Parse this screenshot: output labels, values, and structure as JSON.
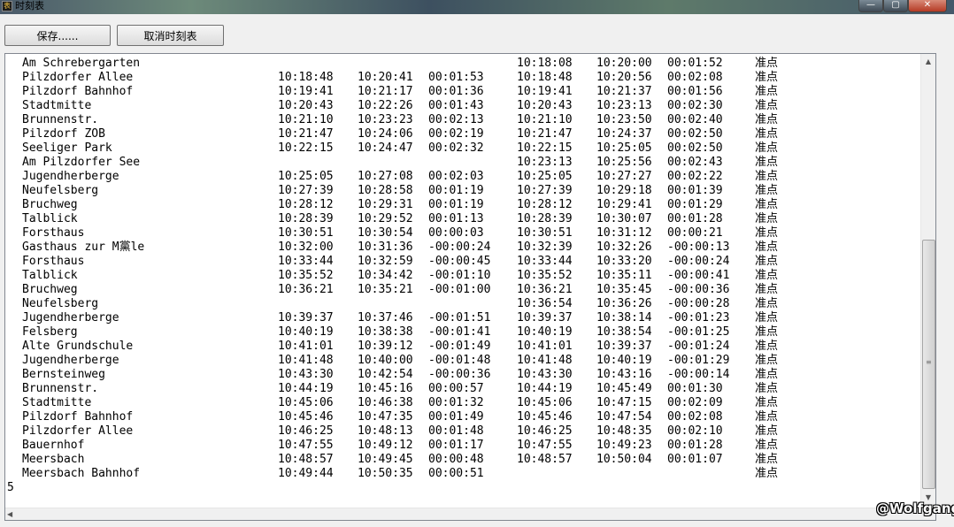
{
  "window": {
    "title": "时刻表",
    "app_icon": "timetable-app-icon",
    "controls": {
      "minimize": "—",
      "maximize": "▢",
      "close": "✕"
    }
  },
  "toolbar": {
    "save_label": "保存......",
    "cancel_label": "取消时刻表"
  },
  "timetable": {
    "rows": [
      [
        "Am Schrebergarten",
        "",
        "",
        "",
        "10:18:08",
        "10:20:00",
        "00:01:52",
        "准点"
      ],
      [
        "Pilzdorfer Allee",
        "10:18:48",
        "10:20:41",
        "00:01:53",
        "10:18:48",
        "10:20:56",
        "00:02:08",
        "准点"
      ],
      [
        "Pilzdorf Bahnhof",
        "10:19:41",
        "10:21:17",
        "00:01:36",
        "10:19:41",
        "10:21:37",
        "00:01:56",
        "准点"
      ],
      [
        "Stadtmitte",
        "10:20:43",
        "10:22:26",
        "00:01:43",
        "10:20:43",
        "10:23:13",
        "00:02:30",
        "准点"
      ],
      [
        "Brunnenstr.",
        "10:21:10",
        "10:23:23",
        "00:02:13",
        "10:21:10",
        "10:23:50",
        "00:02:40",
        "准点"
      ],
      [
        "Pilzdorf ZOB",
        "10:21:47",
        "10:24:06",
        "00:02:19",
        "10:21:47",
        "10:24:37",
        "00:02:50",
        "准点"
      ],
      [
        "Seeliger Park",
        "10:22:15",
        "10:24:47",
        "00:02:32",
        "10:22:15",
        "10:25:05",
        "00:02:50",
        "准点"
      ],
      [
        "Am Pilzdorfer See",
        "",
        "",
        "",
        "10:23:13",
        "10:25:56",
        "00:02:43",
        "准点"
      ],
      [
        "Jugendherberge",
        "10:25:05",
        "10:27:08",
        "00:02:03",
        "10:25:05",
        "10:27:27",
        "00:02:22",
        "准点"
      ],
      [
        "Neufelsberg",
        "10:27:39",
        "10:28:58",
        "00:01:19",
        "10:27:39",
        "10:29:18",
        "00:01:39",
        "准点"
      ],
      [
        "Bruchweg",
        "10:28:12",
        "10:29:31",
        "00:01:19",
        "10:28:12",
        "10:29:41",
        "00:01:29",
        "准点"
      ],
      [
        "Talblick",
        "10:28:39",
        "10:29:52",
        "00:01:13",
        "10:28:39",
        "10:30:07",
        "00:01:28",
        "准点"
      ],
      [
        "Forsthaus",
        "10:30:51",
        "10:30:54",
        "00:00:03",
        "10:30:51",
        "10:31:12",
        "00:00:21",
        "准点"
      ],
      [
        "Gasthaus zur M黨le",
        "10:32:00",
        "10:31:36",
        "-00:00:24",
        "10:32:39",
        "10:32:26",
        "-00:00:13",
        "准点"
      ],
      [
        "Forsthaus",
        "10:33:44",
        "10:32:59",
        "-00:00:45",
        "10:33:44",
        "10:33:20",
        "-00:00:24",
        "准点"
      ],
      [
        "Talblick",
        "10:35:52",
        "10:34:42",
        "-00:01:10",
        "10:35:52",
        "10:35:11",
        "-00:00:41",
        "准点"
      ],
      [
        "Bruchweg",
        "10:36:21",
        "10:35:21",
        "-00:01:00",
        "10:36:21",
        "10:35:45",
        "-00:00:36",
        "准点"
      ],
      [
        "Neufelsberg",
        "",
        "",
        "",
        "10:36:54",
        "10:36:26",
        "-00:00:28",
        "准点"
      ],
      [
        "Jugendherberge",
        "10:39:37",
        "10:37:46",
        "-00:01:51",
        "10:39:37",
        "10:38:14",
        "-00:01:23",
        "准点"
      ],
      [
        "Felsberg",
        "10:40:19",
        "10:38:38",
        "-00:01:41",
        "10:40:19",
        "10:38:54",
        "-00:01:25",
        "准点"
      ],
      [
        "Alte Grundschule",
        "10:41:01",
        "10:39:12",
        "-00:01:49",
        "10:41:01",
        "10:39:37",
        "-00:01:24",
        "准点"
      ],
      [
        "Jugendherberge",
        "10:41:48",
        "10:40:00",
        "-00:01:48",
        "10:41:48",
        "10:40:19",
        "-00:01:29",
        "准点"
      ],
      [
        "Bernsteinweg",
        "10:43:30",
        "10:42:54",
        "-00:00:36",
        "10:43:30",
        "10:43:16",
        "-00:00:14",
        "准点"
      ],
      [
        "Brunnenstr.",
        "10:44:19",
        "10:45:16",
        "00:00:57",
        "10:44:19",
        "10:45:49",
        "00:01:30",
        "准点"
      ],
      [
        "Stadtmitte",
        "10:45:06",
        "10:46:38",
        "00:01:32",
        "10:45:06",
        "10:47:15",
        "00:02:09",
        "准点"
      ],
      [
        "Pilzdorf Bahnhof",
        "10:45:46",
        "10:47:35",
        "00:01:49",
        "10:45:46",
        "10:47:54",
        "00:02:08",
        "准点"
      ],
      [
        "Pilzdorfer Allee",
        "10:46:25",
        "10:48:13",
        "00:01:48",
        "10:46:25",
        "10:48:35",
        "00:02:10",
        "准点"
      ],
      [
        "Bauernhof",
        "10:47:55",
        "10:49:12",
        "00:01:17",
        "10:47:55",
        "10:49:23",
        "00:01:28",
        "准点"
      ],
      [
        "Meersbach",
        "10:48:57",
        "10:49:45",
        "00:00:48",
        "10:48:57",
        "10:50:04",
        "00:01:07",
        "准点"
      ],
      [
        "Meersbach Bahnhof",
        "10:49:44",
        "10:50:35",
        "00:00:51",
        "",
        "",
        "",
        "准点"
      ]
    ],
    "trailing_text": "5"
  },
  "scrollbars": {
    "up_icon": "▲",
    "down_icon": "▼",
    "left_icon": "◀",
    "grip": "≡"
  },
  "watermark": "@Wolfgang"
}
